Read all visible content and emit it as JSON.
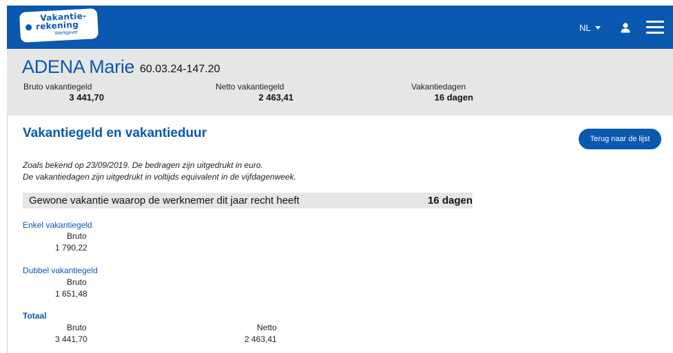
{
  "header": {
    "logo": {
      "line1": "Vakantie-",
      "line2": "rekening",
      "sub": "Werkgever"
    },
    "language": "NL",
    "icons": {
      "user": "user-icon",
      "menu": "hamburger-menu-icon"
    },
    "colors": {
      "primary": "#0a58b0",
      "summary_bg": "#e6e6e6"
    }
  },
  "employee": {
    "name": "ADENA Marie",
    "id": "60.03.24-147.20"
  },
  "summary": {
    "bruto_label": "Bruto vakantiegeld",
    "bruto_value": "3 441,70",
    "netto_label": "Netto vakantiegeld",
    "netto_value": "2 463,41",
    "days_label": "Vakantiedagen",
    "days_value": "16 dagen"
  },
  "main": {
    "title": "Vakantiegeld en vakantieduur",
    "back_button": "Terug naar de lijst",
    "note_line1": "Zoals bekend op 23/09/2019. De bedragen zijn uitgedrukt in euro.",
    "note_line2": "De vakantiedagen zijn uitgedrukt in voltijds equivalent in de vijfdagenweek.",
    "holiday_label": "Gewone vakantie waarop de werknemer dit jaar recht heeft",
    "holiday_value": "16 dagen",
    "enkel": {
      "title": "Enkel vakantiegeld",
      "bruto_label": "Bruto",
      "bruto_value": "1 790,22"
    },
    "dubbel": {
      "title": "Dubbel vakantiegeld",
      "bruto_label": "Bruto",
      "bruto_value": "1 651,48"
    },
    "totaal": {
      "title": "Totaal",
      "bruto_label": "Bruto",
      "bruto_value": "3 441,70",
      "netto_label": "Netto",
      "netto_value": "2 463,41"
    }
  }
}
